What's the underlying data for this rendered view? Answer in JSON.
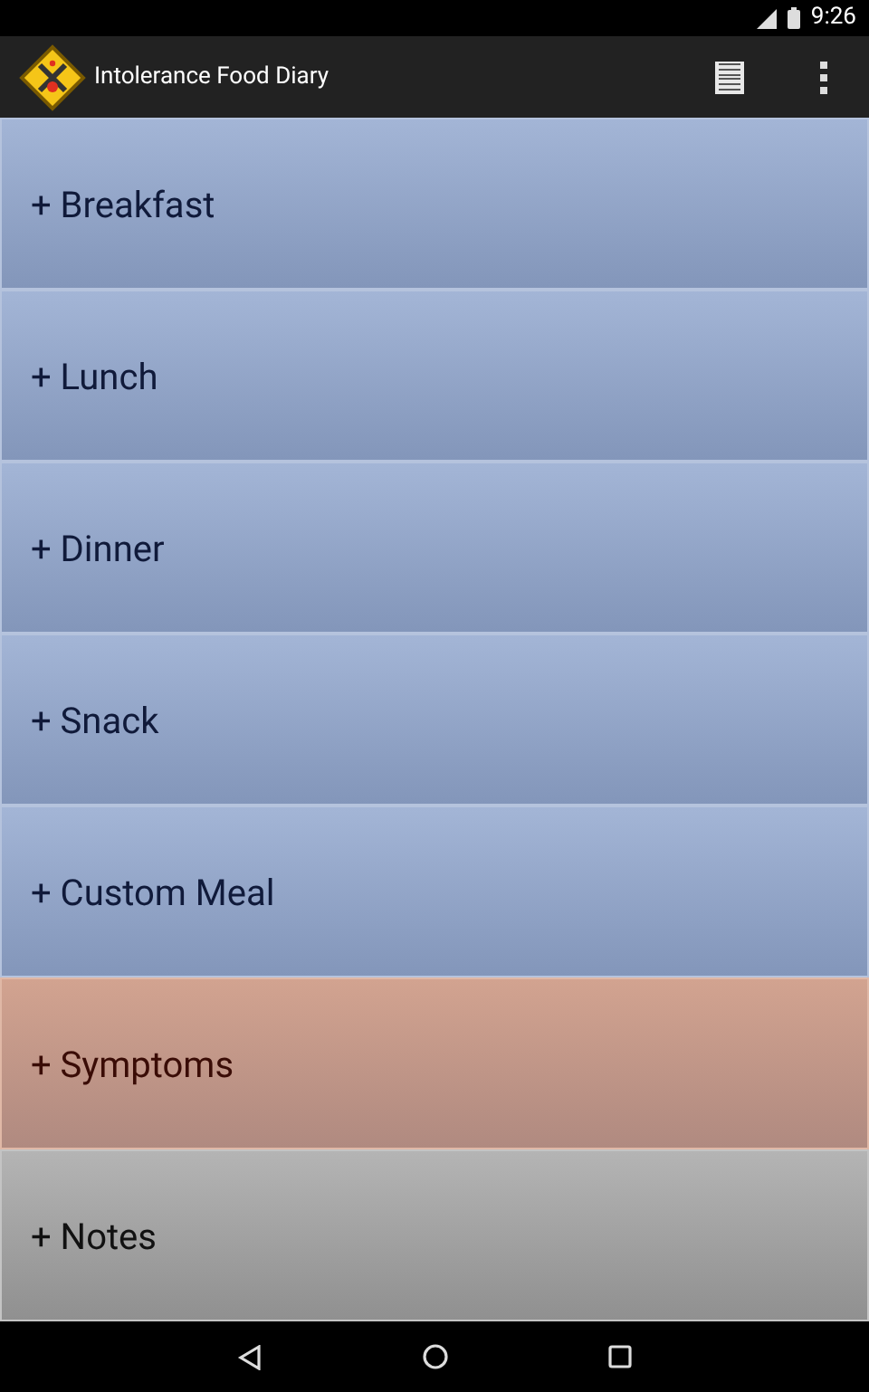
{
  "status_bar": {
    "time": "9:26"
  },
  "app_bar": {
    "title": "Intolerance Food Diary"
  },
  "sections": [
    {
      "label": "+ Breakfast",
      "kind": "meal"
    },
    {
      "label": "+ Lunch",
      "kind": "meal"
    },
    {
      "label": "+ Dinner",
      "kind": "meal"
    },
    {
      "label": "+ Snack",
      "kind": "meal"
    },
    {
      "label": "+ Custom Meal",
      "kind": "meal"
    },
    {
      "label": "+ Symptoms",
      "kind": "symptoms"
    },
    {
      "label": "+ Notes",
      "kind": "notes"
    }
  ]
}
